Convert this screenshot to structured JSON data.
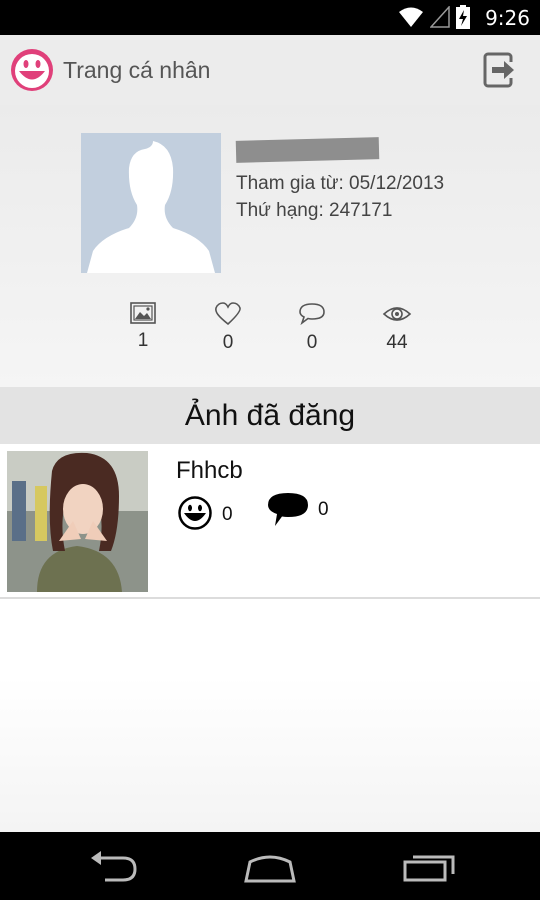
{
  "status_bar": {
    "time": "9:26",
    "icons": [
      "wifi-icon",
      "signal-icon",
      "battery-charging-icon"
    ]
  },
  "action_bar": {
    "title": "Trang cá nhân",
    "logo_icon": "smiley-logo-icon",
    "action_icon": "logout-icon"
  },
  "profile": {
    "join_date": "Tham gia từ: 05/12/2013",
    "rank": "Thứ hạng: 247171",
    "stats": [
      {
        "icon": "image-icon",
        "value": "1"
      },
      {
        "icon": "heart-icon",
        "value": "0"
      },
      {
        "icon": "comment-icon",
        "value": "0"
      },
      {
        "icon": "eye-icon",
        "value": "44"
      }
    ]
  },
  "posts_section": {
    "title": "Ảnh đã đăng",
    "posts": [
      {
        "title": "Fhhcb",
        "likes": "0",
        "comments": "0"
      }
    ]
  },
  "nav_bar": {
    "buttons": [
      "back-icon",
      "home-icon",
      "recent-apps-icon"
    ]
  },
  "colors": {
    "accent": "#e0407a",
    "action_bar": "#ececec",
    "avatar_bg": "#c2cfde",
    "section_header": "#e3e3e3"
  }
}
